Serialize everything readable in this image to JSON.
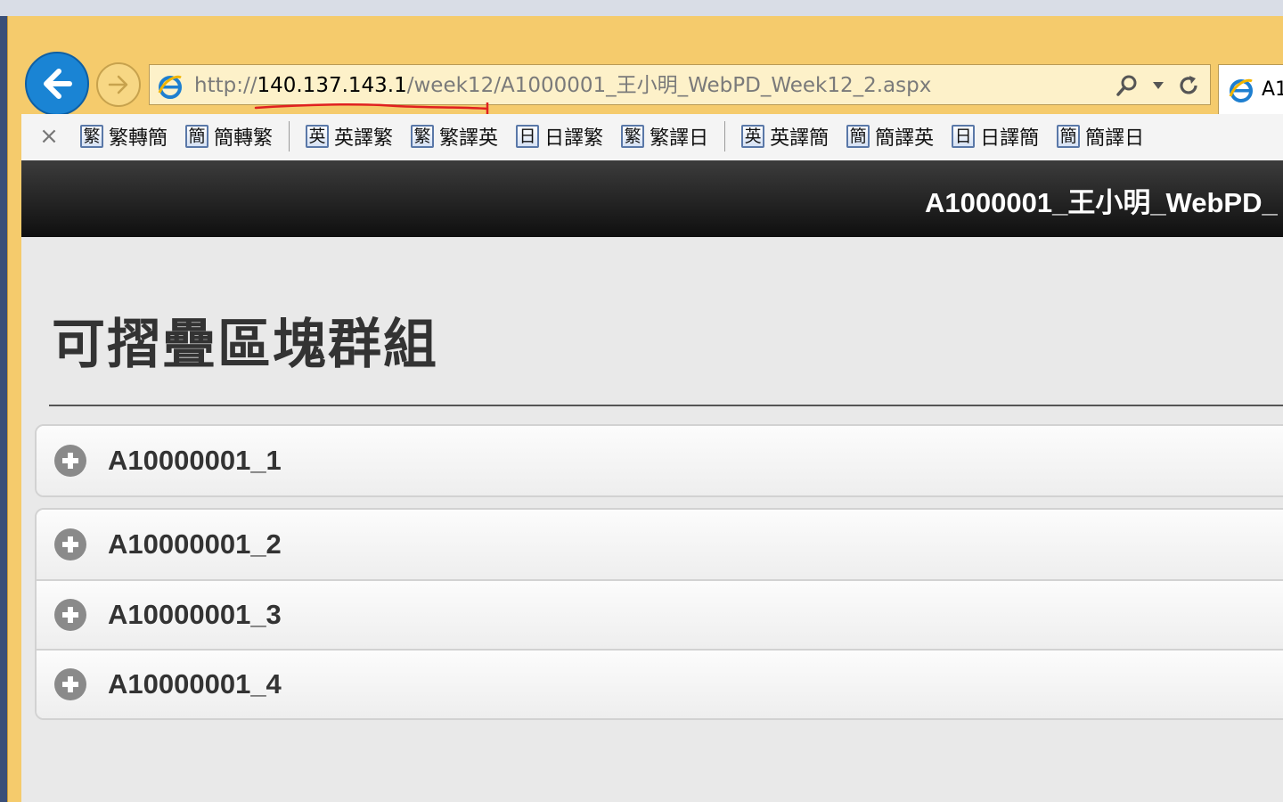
{
  "browser": {
    "url_prefix": "http://",
    "url_host": "140.137.143.1",
    "url_path": "/week12/A1000001_王小明_WebPD_Week12_2.aspx",
    "tab_title": "A1"
  },
  "toolbar": {
    "close_label": "×",
    "items": [
      {
        "icon": "繁",
        "label": "繁轉簡"
      },
      {
        "icon": "簡",
        "label": "簡轉繁"
      },
      {
        "icon": "英",
        "label": "英譯繁"
      },
      {
        "icon": "繁",
        "label": "繁譯英"
      },
      {
        "icon": "日",
        "label": "日譯繁"
      },
      {
        "icon": "繁",
        "label": "繁譯日"
      },
      {
        "icon": "英",
        "label": "英譯簡"
      },
      {
        "icon": "簡",
        "label": "簡譯英"
      },
      {
        "icon": "日",
        "label": "日譯簡"
      },
      {
        "icon": "簡",
        "label": "簡譯日"
      }
    ]
  },
  "page": {
    "header_title": "A1000001_王小明_WebPD_",
    "title": "可摺疊區塊群組",
    "collapsibles": [
      {
        "label": "A10000001_1"
      },
      {
        "label": "A10000001_2"
      },
      {
        "label": "A10000001_3"
      },
      {
        "label": "A10000001_4"
      }
    ]
  },
  "colors": {
    "frame": "#f5cb6c",
    "back_button": "#1a84d4",
    "header_bar": "#1a1a1a",
    "annotation": "#e02020"
  }
}
